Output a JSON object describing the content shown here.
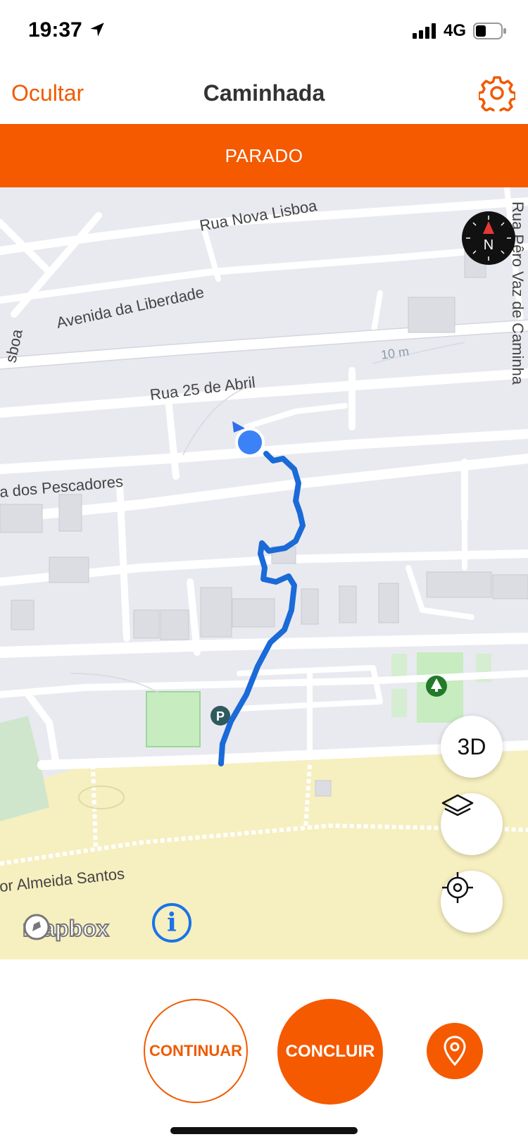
{
  "status_bar": {
    "time": "19:37",
    "network": "4G"
  },
  "header": {
    "left_action": "Ocultar",
    "title": "Caminhada"
  },
  "banner": {
    "status": "PARADO"
  },
  "map": {
    "labels": {
      "rua_nova_lisboa": "Rua Nova Lisboa",
      "avenida_liberdade": "Avenida da Liberdade",
      "rua_25_abril": "Rua 25 de Abril",
      "pescadores": "a dos Pescadores",
      "almeida_santos": "or Almeida Santos",
      "pero_vaz": "Rua Pêro Vaz de Caminha",
      "lisboa_left": "sboa",
      "scale": "10 m"
    },
    "compass_letter": "N",
    "btn_3d": "3D",
    "attribution": "mapbox",
    "info_symbol": "i"
  },
  "controls": {
    "continue": "CONTINUAR",
    "finish": "CONCLUIR"
  },
  "colors": {
    "accent": "#f55a00",
    "route": "#1a6ad8",
    "location": "#3b82f6"
  },
  "icons": [
    "location-arrow-icon",
    "signal-icon",
    "battery-icon",
    "gear-icon",
    "layers-icon",
    "crosshair-icon",
    "map-pin-icon",
    "parking-icon",
    "tree-icon",
    "compass-icon"
  ]
}
